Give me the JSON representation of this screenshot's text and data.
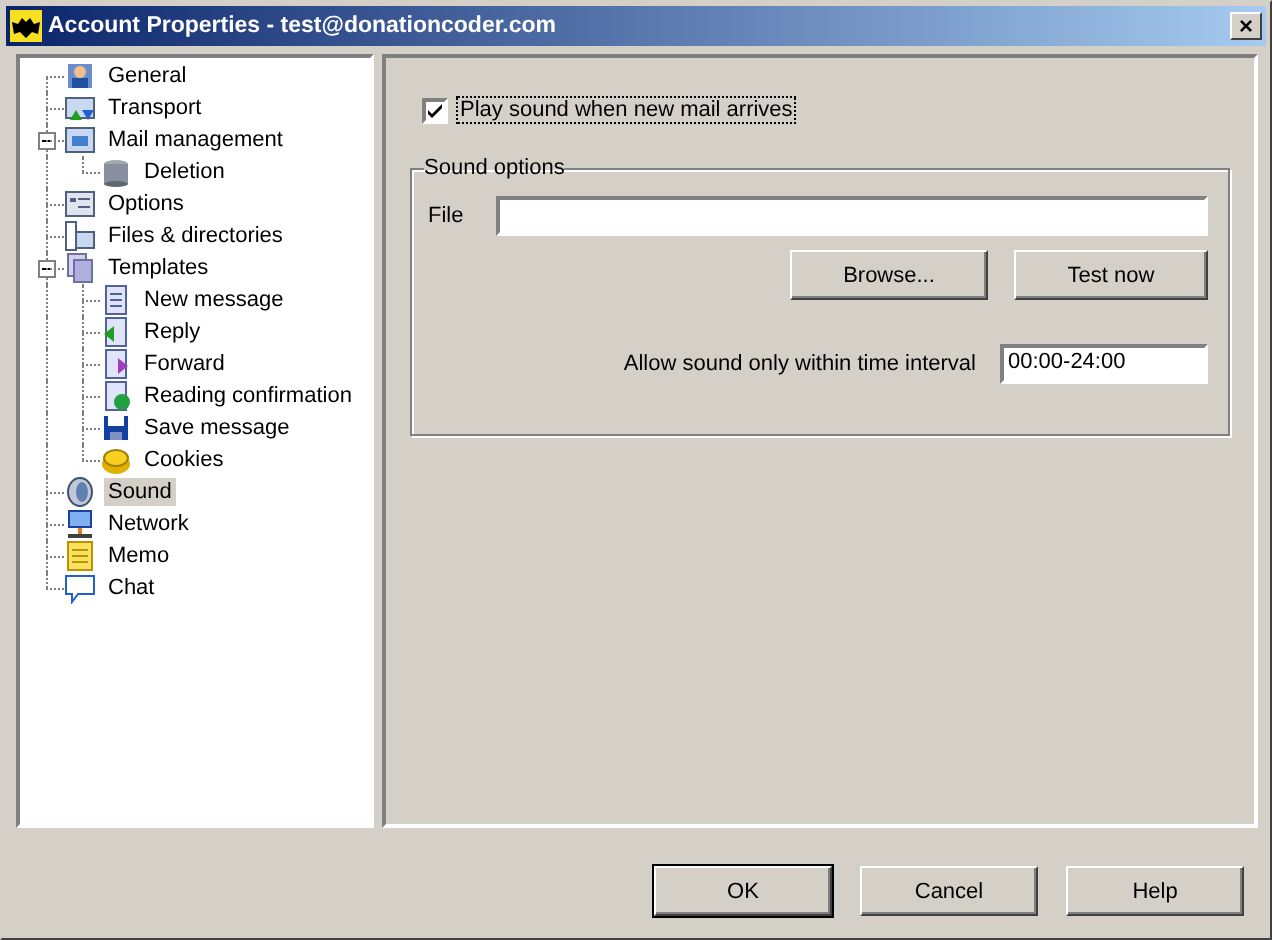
{
  "window": {
    "title": "Account Properties - test@donationcoder.com",
    "close": "×"
  },
  "tree": [
    {
      "label": "General",
      "selected": false
    },
    {
      "label": "Transport",
      "selected": false
    },
    {
      "label": "Mail management",
      "selected": false,
      "expanded": true,
      "children": [
        {
          "label": "Deletion",
          "selected": false
        }
      ]
    },
    {
      "label": "Options",
      "selected": false
    },
    {
      "label": "Files & directories",
      "selected": false
    },
    {
      "label": "Templates",
      "selected": false,
      "expanded": true,
      "children": [
        {
          "label": "New message",
          "selected": false
        },
        {
          "label": "Reply",
          "selected": false
        },
        {
          "label": "Forward",
          "selected": false
        },
        {
          "label": "Reading confirmation",
          "selected": false
        },
        {
          "label": "Save message",
          "selected": false
        },
        {
          "label": "Cookies",
          "selected": false
        }
      ]
    },
    {
      "label": "Sound",
      "selected": true
    },
    {
      "label": "Network",
      "selected": false
    },
    {
      "label": "Memo",
      "selected": false
    },
    {
      "label": "Chat",
      "selected": false
    }
  ],
  "play_sound": {
    "label": "Play sound when new mail arrives",
    "checked": true
  },
  "sound_options": {
    "title": "Sound options",
    "file_label": "File",
    "browse": {
      "label": "Browse..."
    },
    "test": {
      "label": "Test now"
    },
    "interval_label": {
      "label": "Allow sound only within time interval"
    },
    "interval_value": "00:00-24:00"
  },
  "buttons": [
    {
      "label": "OK",
      "default": true
    },
    {
      "label": "Cancel",
      "default": false
    },
    {
      "label": "Help",
      "default": false
    }
  ]
}
